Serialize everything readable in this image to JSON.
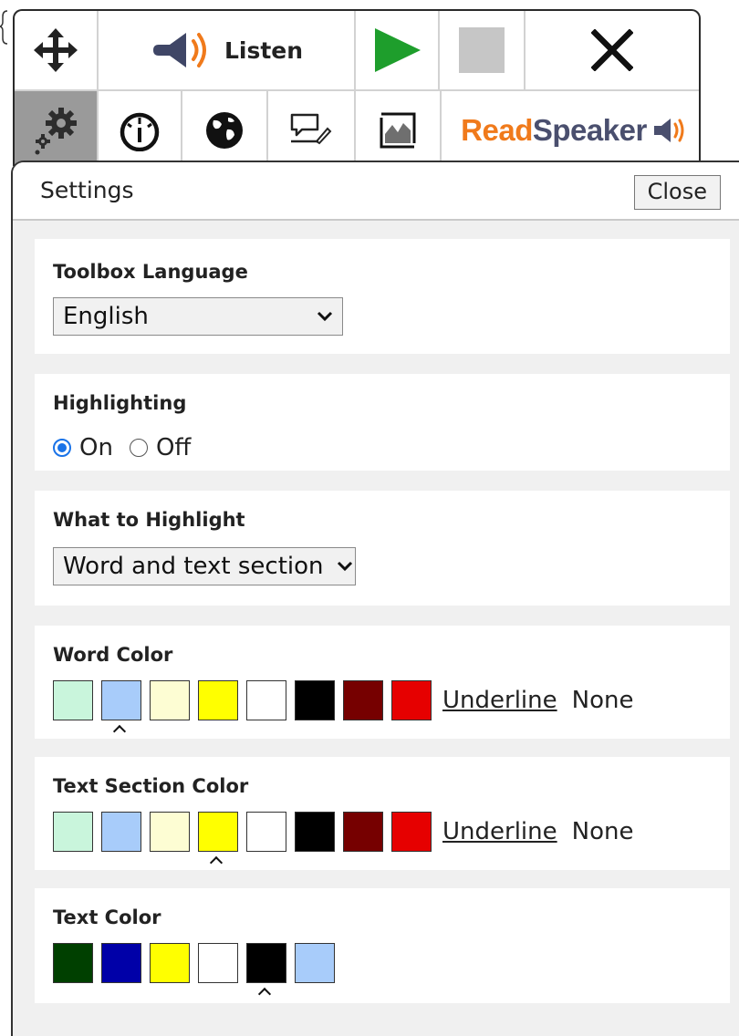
{
  "toolbar": {
    "listen_label": "Listen",
    "brand": {
      "read": "Read",
      "speaker": "Speaker"
    },
    "icons": [
      "move-icon",
      "speaker-icon",
      "play-icon",
      "stop-icon",
      "close-icon",
      "gear-icon",
      "gauge-icon",
      "globe-icon",
      "annotation-icon",
      "image-icon",
      "readspeaker-logo"
    ]
  },
  "settings": {
    "title": "Settings",
    "close_label": "Close",
    "toolbox_language": {
      "label": "Toolbox Language",
      "value": "English"
    },
    "highlighting": {
      "label": "Highlighting",
      "on_label": "On",
      "off_label": "Off",
      "selected": "On"
    },
    "what_to_highlight": {
      "label": "What to Highlight",
      "value": "Word and text section"
    },
    "word_color": {
      "label": "Word Color",
      "swatches": [
        "#c9f5dc",
        "#a8ccfa",
        "#fdfdd3",
        "#ffff00",
        "#ffffff",
        "#000000",
        "#760000",
        "#e60000"
      ],
      "selected_index": 1,
      "underline_label": "Underline",
      "none_label": "None"
    },
    "text_section_color": {
      "label": "Text Section Color",
      "swatches": [
        "#c9f5dc",
        "#a8ccfa",
        "#fdfdd3",
        "#ffff00",
        "#ffffff",
        "#000000",
        "#760000",
        "#e60000"
      ],
      "selected_index": 3,
      "underline_label": "Underline",
      "none_label": "None"
    },
    "text_color": {
      "label": "Text Color",
      "swatches": [
        "#004000",
        "#0000a8",
        "#ffff00",
        "#ffffff",
        "#000000",
        "#a8ccfa"
      ],
      "selected_index": 4
    }
  }
}
